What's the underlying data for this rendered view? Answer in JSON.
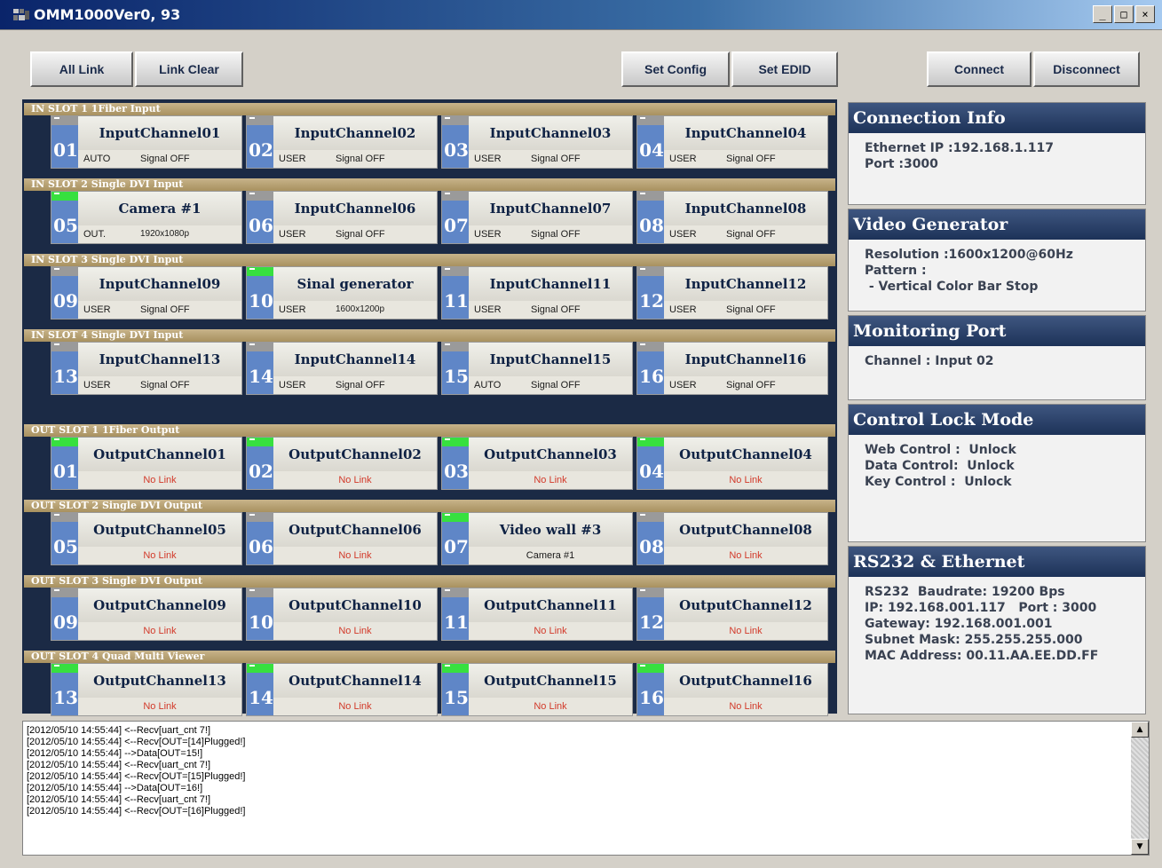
{
  "window": {
    "title": "OMM1000Ver0, 93"
  },
  "toolbar": {
    "all_link": "All Link",
    "link_clear": "Link Clear",
    "set_config": "Set Config",
    "set_edid": "Set EDID",
    "connect": "Connect",
    "disconnect": "Disconnect"
  },
  "in_slots": [
    {
      "label": "IN SLOT 1   1Fiber Input",
      "channels": [
        {
          "num": "01",
          "name": "InputChannel01",
          "mode": "AUTO",
          "status": "Signal OFF",
          "active": false
        },
        {
          "num": "02",
          "name": "InputChannel02",
          "mode": "USER",
          "status": "Signal OFF",
          "active": false
        },
        {
          "num": "03",
          "name": "InputChannel03",
          "mode": "USER",
          "status": "Signal OFF",
          "active": false
        },
        {
          "num": "04",
          "name": "InputChannel04",
          "mode": "USER",
          "status": "Signal OFF",
          "active": false
        }
      ]
    },
    {
      "label": "IN SLOT 2   Single DVI Input",
      "channels": [
        {
          "num": "05",
          "name": "Camera #1",
          "mode": "OUT.",
          "status": "1920x1080p",
          "active": true
        },
        {
          "num": "06",
          "name": "InputChannel06",
          "mode": "USER",
          "status": "Signal OFF",
          "active": false
        },
        {
          "num": "07",
          "name": "InputChannel07",
          "mode": "USER",
          "status": "Signal OFF",
          "active": false
        },
        {
          "num": "08",
          "name": "InputChannel08",
          "mode": "USER",
          "status": "Signal OFF",
          "active": false
        }
      ]
    },
    {
      "label": "IN SLOT 3   Single DVI Input",
      "channels": [
        {
          "num": "09",
          "name": "InputChannel09",
          "mode": "USER",
          "status": "Signal OFF",
          "active": false
        },
        {
          "num": "10",
          "name": "Sinal generator",
          "mode": "USER",
          "status": "1600x1200p",
          "active": true
        },
        {
          "num": "11",
          "name": "InputChannel11",
          "mode": "USER",
          "status": "Signal OFF",
          "active": false
        },
        {
          "num": "12",
          "name": "InputChannel12",
          "mode": "USER",
          "status": "Signal OFF",
          "active": false
        }
      ]
    },
    {
      "label": "IN SLOT 4   Single DVI Input",
      "channels": [
        {
          "num": "13",
          "name": "InputChannel13",
          "mode": "USER",
          "status": "Signal OFF",
          "active": false
        },
        {
          "num": "14",
          "name": "InputChannel14",
          "mode": "USER",
          "status": "Signal OFF",
          "active": false
        },
        {
          "num": "15",
          "name": "InputChannel15",
          "mode": "AUTO",
          "status": "Signal OFF",
          "active": false
        },
        {
          "num": "16",
          "name": "InputChannel16",
          "mode": "USER",
          "status": "Signal OFF",
          "active": false
        }
      ]
    }
  ],
  "out_slots": [
    {
      "label": "OUT SLOT 1   1Fiber Output",
      "channels": [
        {
          "num": "01",
          "name": "OutputChannel01",
          "status": "No Link",
          "active": true
        },
        {
          "num": "02",
          "name": "OutputChannel02",
          "status": "No Link",
          "active": true
        },
        {
          "num": "03",
          "name": "OutputChannel03",
          "status": "No Link",
          "active": true
        },
        {
          "num": "04",
          "name": "OutputChannel04",
          "status": "No Link",
          "active": true
        }
      ]
    },
    {
      "label": "OUT SLOT 2   Single DVI Output",
      "channels": [
        {
          "num": "05",
          "name": "OutputChannel05",
          "status": "No Link",
          "active": false
        },
        {
          "num": "06",
          "name": "OutputChannel06",
          "status": "No Link",
          "active": false
        },
        {
          "num": "07",
          "name": "Video wall #3",
          "status": "Camera #1",
          "active": true,
          "linked": true
        },
        {
          "num": "08",
          "name": "OutputChannel08",
          "status": "No Link",
          "active": false
        }
      ]
    },
    {
      "label": "OUT SLOT 3   Single DVI Output",
      "channels": [
        {
          "num": "09",
          "name": "OutputChannel09",
          "status": "No Link",
          "active": false
        },
        {
          "num": "10",
          "name": "OutputChannel10",
          "status": "No Link",
          "active": false
        },
        {
          "num": "11",
          "name": "OutputChannel11",
          "status": "No Link",
          "active": false
        },
        {
          "num": "12",
          "name": "OutputChannel12",
          "status": "No Link",
          "active": false
        }
      ]
    },
    {
      "label": "OUT SLOT 4   Quad Multi Viewer",
      "channels": [
        {
          "num": "13",
          "name": "OutputChannel13",
          "status": "No Link",
          "active": true
        },
        {
          "num": "14",
          "name": "OutputChannel14",
          "status": "No Link",
          "active": true
        },
        {
          "num": "15",
          "name": "OutputChannel15",
          "status": "No Link",
          "active": true
        },
        {
          "num": "16",
          "name": "OutputChannel16",
          "status": "No Link",
          "active": true
        }
      ]
    }
  ],
  "info": {
    "connection": {
      "title": "Connection Info",
      "body": "Ethernet IP :192.168.1.117\nPort :3000"
    },
    "video": {
      "title": "Video Generator",
      "body": "Resolution :1600x1200@60Hz\nPattern :\n - Vertical Color Bar Stop"
    },
    "monitoring": {
      "title": "Monitoring Port",
      "body": "Channel : Input 02"
    },
    "lock": {
      "title": "Control Lock Mode",
      "body": "Web Control :  Unlock\nData Control:  Unlock\nKey Control :  Unlock"
    },
    "rs232": {
      "title": "RS232 & Ethernet",
      "body": "RS232  Baudrate: 19200 Bps\nIP: 192.168.001.117   Port : 3000\nGateway: 192.168.001.001\nSubnet Mask: 255.255.255.000\nMAC Address: 00.11.AA.EE.DD.FF"
    }
  },
  "log": [
    "[2012/05/10 14:55:44] <--Recv[uart_cnt 7!]",
    "[2012/05/10 14:55:44] <--Recv[OUT=[14]Plugged!]",
    "[2012/05/10 14:55:44] -->Data[OUT=15!]",
    "[2012/05/10 14:55:44] <--Recv[uart_cnt 7!]",
    "[2012/05/10 14:55:44] <--Recv[OUT=[15]Plugged!]",
    "[2012/05/10 14:55:44] -->Data[OUT=16!]",
    "[2012/05/10 14:55:44] <--Recv[uart_cnt 7!]",
    "[2012/05/10 14:55:44] <--Recv[OUT=[16]Plugged!]"
  ],
  "colors": {
    "active_tag": "#37e03f",
    "inactive_tag": "#9a9a9a",
    "channel_number_bg": "#5f86c7",
    "no_link_text": "#d23a2a"
  },
  "icons": {
    "app": "matrix-app-icon",
    "minimize": "minimize-icon",
    "maximize": "maximize-icon",
    "close": "close-icon"
  }
}
